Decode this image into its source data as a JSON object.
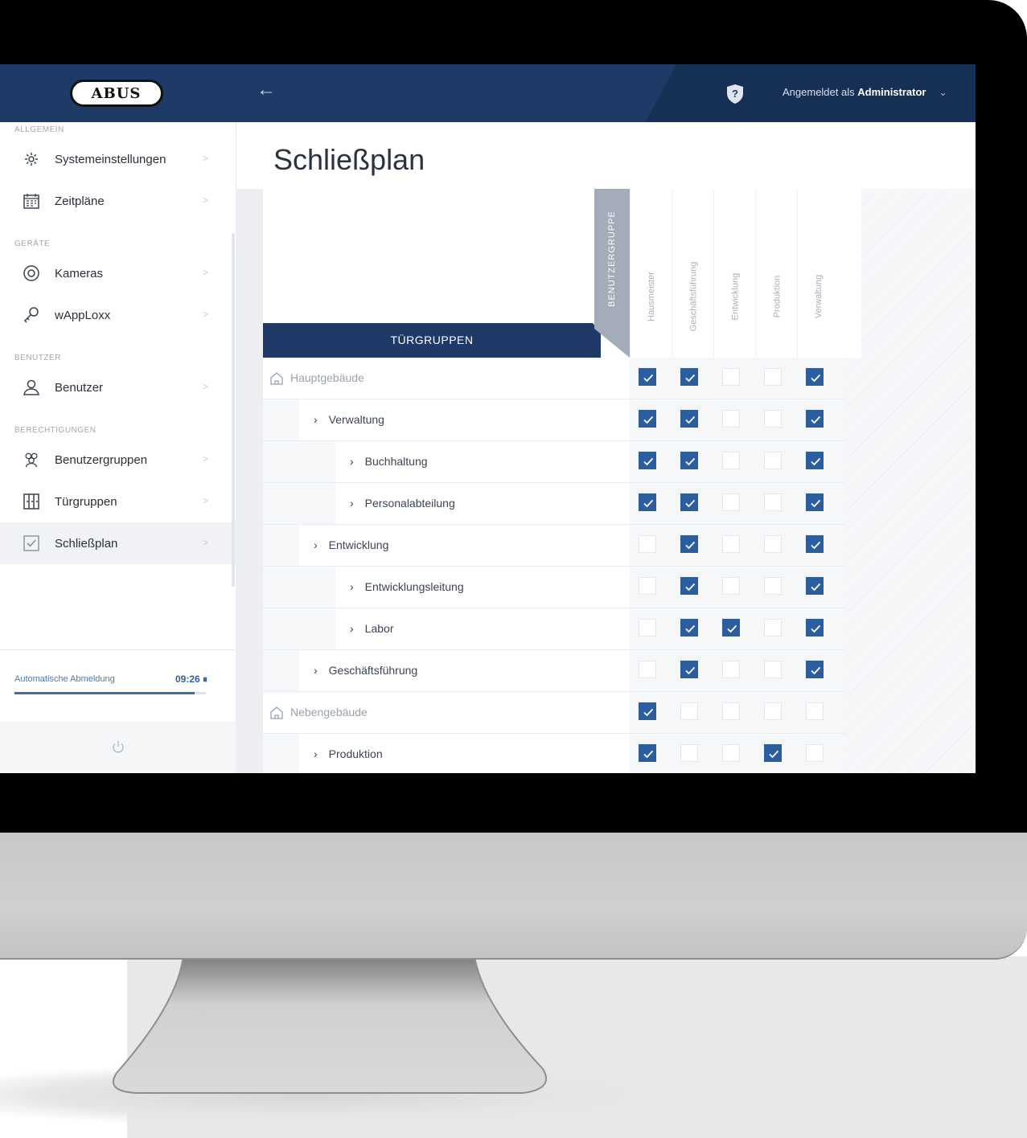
{
  "sidebar": {
    "logo": "ABUS",
    "sections": [
      {
        "label": "ALLGEMEIN",
        "items": [
          {
            "label": "Systemeinstellungen",
            "icon": "gear-icon"
          },
          {
            "label": "Zeitpläne",
            "icon": "calendar-icon"
          }
        ]
      },
      {
        "label": "GERÄTE",
        "items": [
          {
            "label": "Kameras",
            "icon": "camera-icon"
          },
          {
            "label": "wAppLoxx",
            "icon": "key-icon"
          }
        ]
      },
      {
        "label": "BENUTZER",
        "items": [
          {
            "label": "Benutzer",
            "icon": "user-icon"
          }
        ]
      },
      {
        "label": "BERECHTIGUNGEN",
        "items": [
          {
            "label": "Benutzergruppen",
            "icon": "user-group-icon"
          },
          {
            "label": "Türgruppen",
            "icon": "door-icon"
          },
          {
            "label": "Schließplan",
            "icon": "checkbox-icon",
            "active": true
          }
        ]
      }
    ],
    "auto_logout": {
      "label": "Automatische Abmeldung",
      "time": "09:26 ⏸",
      "progress": 0.94
    }
  },
  "topbar": {
    "user_prefix": "Angemeldet als",
    "user_name": "Administrator"
  },
  "page": {
    "title": "Schließplan"
  },
  "matrix": {
    "door_header": "TÜRGRUPPEN",
    "user_header": "BENUTZERGRUPPE",
    "columns": [
      "Hausmeister",
      "Geschäftsführung",
      "Entwicklung",
      "Produktion",
      "Verwaltung"
    ],
    "rows": [
      {
        "label": "Hauptgebäude",
        "level": 0,
        "type": "building",
        "checks": [
          true,
          true,
          false,
          false,
          true
        ]
      },
      {
        "label": "Verwaltung",
        "level": 1,
        "type": "group",
        "checks": [
          true,
          true,
          false,
          false,
          true
        ]
      },
      {
        "label": "Buchhaltung",
        "level": 2,
        "type": "group",
        "checks": [
          true,
          true,
          false,
          false,
          true
        ]
      },
      {
        "label": "Personalabteilung",
        "level": 2,
        "type": "group",
        "checks": [
          true,
          true,
          false,
          false,
          true
        ]
      },
      {
        "label": "Entwicklung",
        "level": 1,
        "type": "group",
        "checks": [
          false,
          true,
          false,
          false,
          true
        ]
      },
      {
        "label": "Entwicklungsleitung",
        "level": 2,
        "type": "group",
        "checks": [
          false,
          true,
          false,
          false,
          true
        ]
      },
      {
        "label": "Labor",
        "level": 2,
        "type": "group",
        "checks": [
          false,
          true,
          true,
          false,
          true
        ]
      },
      {
        "label": "Geschäftsführung",
        "level": 1,
        "type": "group",
        "checks": [
          false,
          true,
          false,
          false,
          true
        ]
      },
      {
        "label": "Nebengebäude",
        "level": 0,
        "type": "building",
        "checks": [
          true,
          false,
          false,
          false,
          false
        ]
      },
      {
        "label": "Produktion",
        "level": 1,
        "type": "group",
        "checks": [
          true,
          false,
          false,
          true,
          false
        ]
      }
    ]
  },
  "colors": {
    "primary": "#1e3a66",
    "checkbox": "#2b5d9f",
    "accent": "#3b6ea8"
  }
}
